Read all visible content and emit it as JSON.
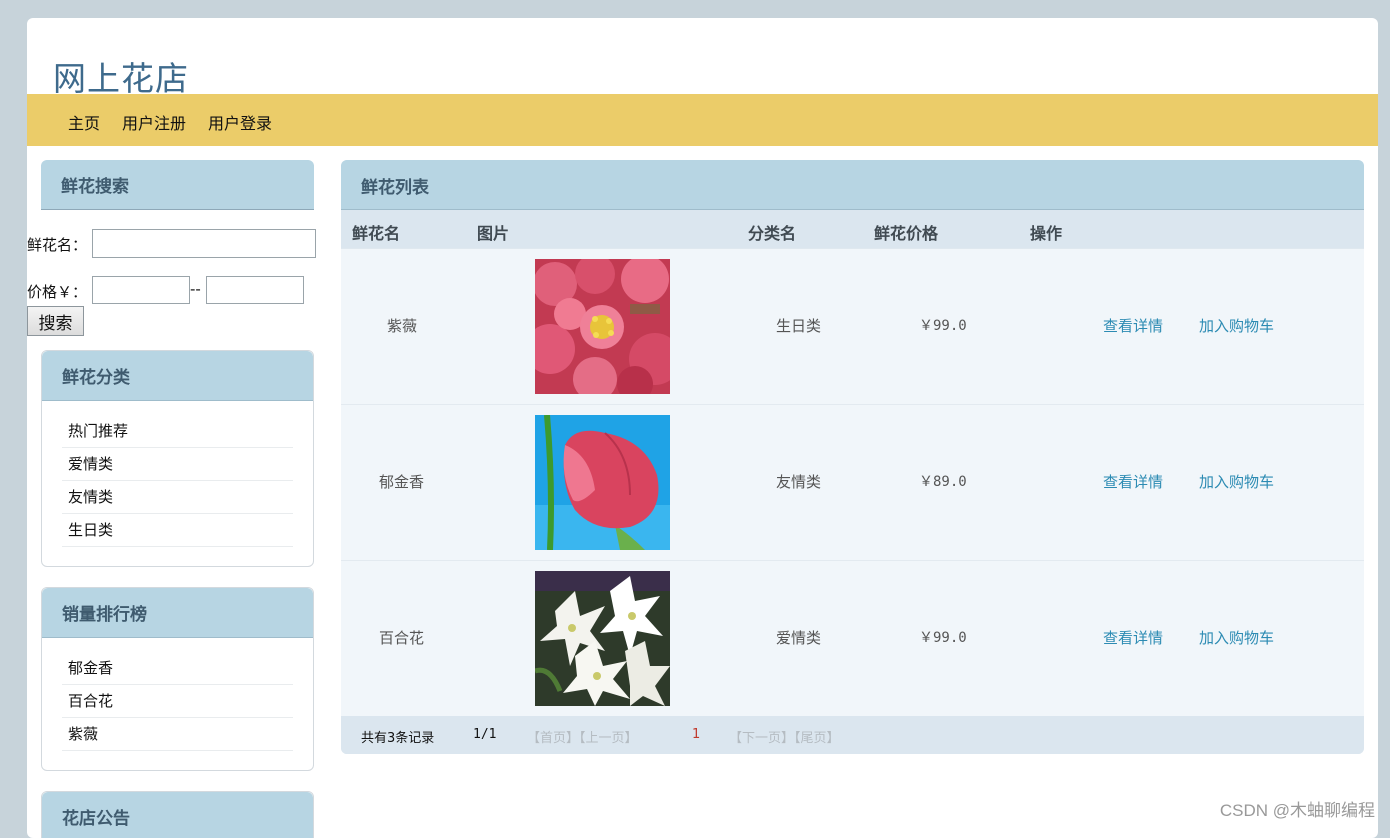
{
  "site_title": "网上花店",
  "nav": [
    "主页",
    "用户注册",
    "用户登录"
  ],
  "search": {
    "title": "鲜花搜索",
    "name_label": "鲜花名：",
    "price_label": "价格￥：",
    "range_sep": "--",
    "button": "搜索"
  },
  "categories": {
    "title": "鲜花分类",
    "items": [
      "热门推荐",
      "爱情类",
      "友情类",
      "生日类"
    ]
  },
  "ranking": {
    "title": "销量排行榜",
    "items": [
      "郁金香",
      "百合花",
      "紫薇"
    ]
  },
  "notice": {
    "title": "花店公告"
  },
  "list": {
    "title": "鲜花列表",
    "columns": [
      "鲜花名",
      "图片",
      "分类名",
      "鲜花价格",
      "操作"
    ],
    "rows": [
      {
        "name": "紫薇",
        "image": "crape-myrtle-flower-photo",
        "category": "生日类",
        "price": "￥99.0",
        "detail": "查看详情",
        "cart": "加入购物车"
      },
      {
        "name": "郁金香",
        "image": "tulip-flower-photo",
        "category": "友情类",
        "price": "￥89.0",
        "detail": "查看详情",
        "cart": "加入购物车"
      },
      {
        "name": "百合花",
        "image": "lily-flower-photo",
        "category": "爱情类",
        "price": "￥99.0",
        "detail": "查看详情",
        "cart": "加入购物车"
      }
    ],
    "pager": {
      "total": "共有3条记录",
      "page": "1/1",
      "first_prev": "【首页】【上一页】",
      "current": "1",
      "next_last": "【下一页】【尾页】"
    }
  },
  "watermark": "CSDN @木蚰聊编程",
  "colors": {
    "nav_bg": "#ebcc69",
    "panel_head": "#b7d5e3",
    "link": "#2c8bb3",
    "title": "#3e6a8c"
  }
}
